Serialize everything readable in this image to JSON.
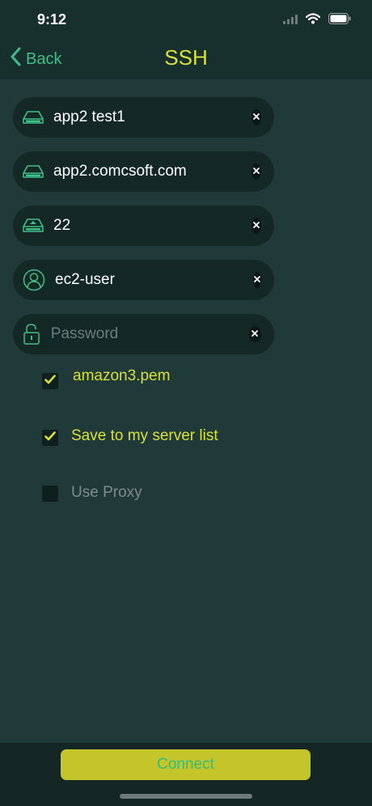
{
  "status_bar": {
    "time": "9:12"
  },
  "nav": {
    "back_label": "Back",
    "title": "SSH"
  },
  "fields": [
    {
      "icon": "server-drive-icon",
      "value": "app2 test1",
      "placeholder": ""
    },
    {
      "icon": "server-drive-icon",
      "value": "app2.comcsoft.com",
      "placeholder": ""
    },
    {
      "icon": "port-drive-icon",
      "value": "22",
      "placeholder": ""
    },
    {
      "icon": "user-icon",
      "value": "ec2-user",
      "placeholder": ""
    },
    {
      "icon": "unlock-icon",
      "value": "",
      "placeholder": "Password"
    }
  ],
  "options": [
    {
      "label": "amazon3.pem",
      "checked": true,
      "color": "#d8e13a"
    },
    {
      "label": "Save to my server list",
      "checked": true,
      "color": "#d8e13a"
    },
    {
      "label": "Use Proxy",
      "checked": false,
      "color": "#7f8c8a"
    }
  ],
  "connect_label": "Connect",
  "colors": {
    "accent": "#d8e13a",
    "green": "#3fbf86",
    "background": "#1f3a38",
    "button": "#c3c52a"
  }
}
